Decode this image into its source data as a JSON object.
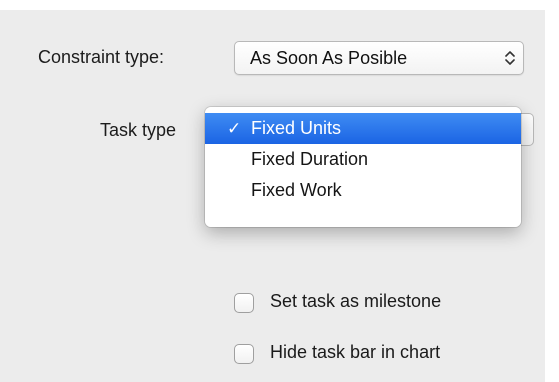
{
  "form": {
    "constraint_label": "Constraint type:",
    "constraint_value": "As Soon As Posible",
    "task_type_label": "Task type"
  },
  "task_type_menu": {
    "items": [
      {
        "label": "Fixed Units",
        "selected": true,
        "check": "✓"
      },
      {
        "label": "Fixed Duration",
        "selected": false,
        "check": ""
      },
      {
        "label": "Fixed Work",
        "selected": false,
        "check": ""
      }
    ]
  },
  "options": {
    "milestone_label": "Set task as milestone",
    "milestone_checked": false,
    "hide_bar_label": "Hide task bar in chart",
    "hide_bar_checked": false
  },
  "colors": {
    "selection": "#1b64e4",
    "panel": "#ececec"
  },
  "icons": {
    "popup_arrows": "up-down-chevron-icon",
    "checkmark": "checkmark-icon"
  }
}
